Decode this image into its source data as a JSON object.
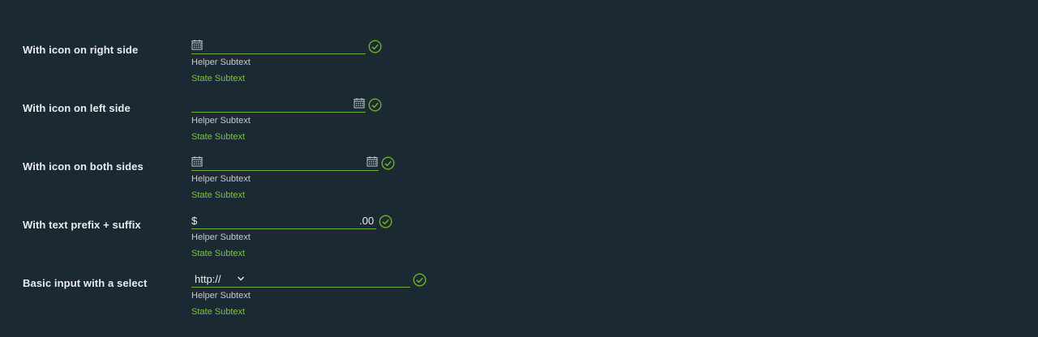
{
  "colors": {
    "background": "#1b2a32",
    "success": "#6fb12e",
    "text": "#e9ecef",
    "helper_text": "#c5ccd0"
  },
  "rows": [
    {
      "label": "With icon on right side",
      "helper": "Helper Subtext",
      "state": "State Subtext",
      "icon": "calendar-icon"
    },
    {
      "label": "With icon on left side",
      "helper": "Helper Subtext",
      "state": "State Subtext",
      "icon": "calendar-icon"
    },
    {
      "label": "With icon on both sides",
      "helper": "Helper Subtext",
      "state": "State Subtext",
      "icon": "calendar-icon"
    },
    {
      "label": "With text prefix + suffix",
      "helper": "Helper Subtext",
      "state": "State Subtext",
      "prefix": "$",
      "suffix": ".00"
    },
    {
      "label": "Basic input with a select",
      "helper": "Helper Subtext",
      "state": "State Subtext",
      "select_value": "http://"
    }
  ],
  "status_icon": "success-check-icon"
}
